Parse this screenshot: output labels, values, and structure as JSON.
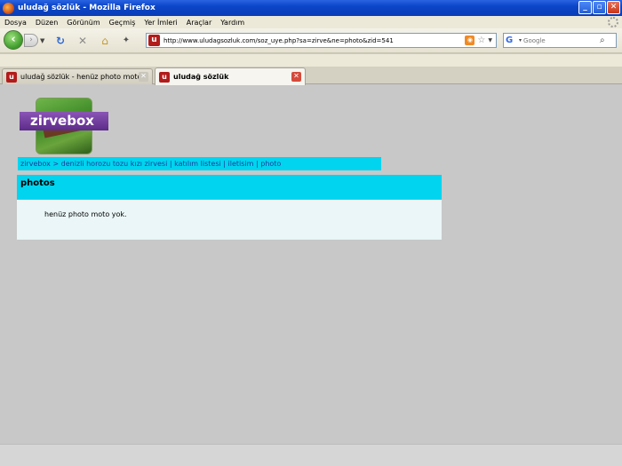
{
  "window": {
    "title": "uludağ sözlük - Mozilla Firefox",
    "buttons": {
      "minimize": "_",
      "maximize": "▫",
      "close": "✕"
    }
  },
  "menu": [
    "Dosya",
    "Düzen",
    "Görünüm",
    "Geçmiş",
    "Yer İmleri",
    "Araçlar",
    "Yardım"
  ],
  "toolbar": {
    "url": "http://www.uludagsozluk.com/soz_uye.php?sa=zirve&ne=photo&zid=541",
    "search_placeholder": "Google",
    "site_icon_letter": "u",
    "search_engine_letter": "G"
  },
  "tabs": [
    {
      "label": "uludağ sözlük - henüz photo moto yok ...",
      "active": false
    },
    {
      "label": "uludağ sözlük",
      "active": true
    }
  ],
  "page": {
    "logo_text": "zirvebox",
    "breadcrumb": {
      "home": "zirvebox",
      "arrow": ">",
      "event": "denizli horozu tozu kızı zirvesi",
      "participants": "katılım listesi",
      "contact": "iletisim",
      "current": "photo"
    },
    "panel_title": "photos",
    "panel_message": "henüz photo moto yok."
  },
  "colors": {
    "accent_cyan": "#00d4ef",
    "link_blue": "#1b3d9a",
    "page_bg": "#c8c8c8",
    "logo_purple": "#6e3a9e"
  }
}
